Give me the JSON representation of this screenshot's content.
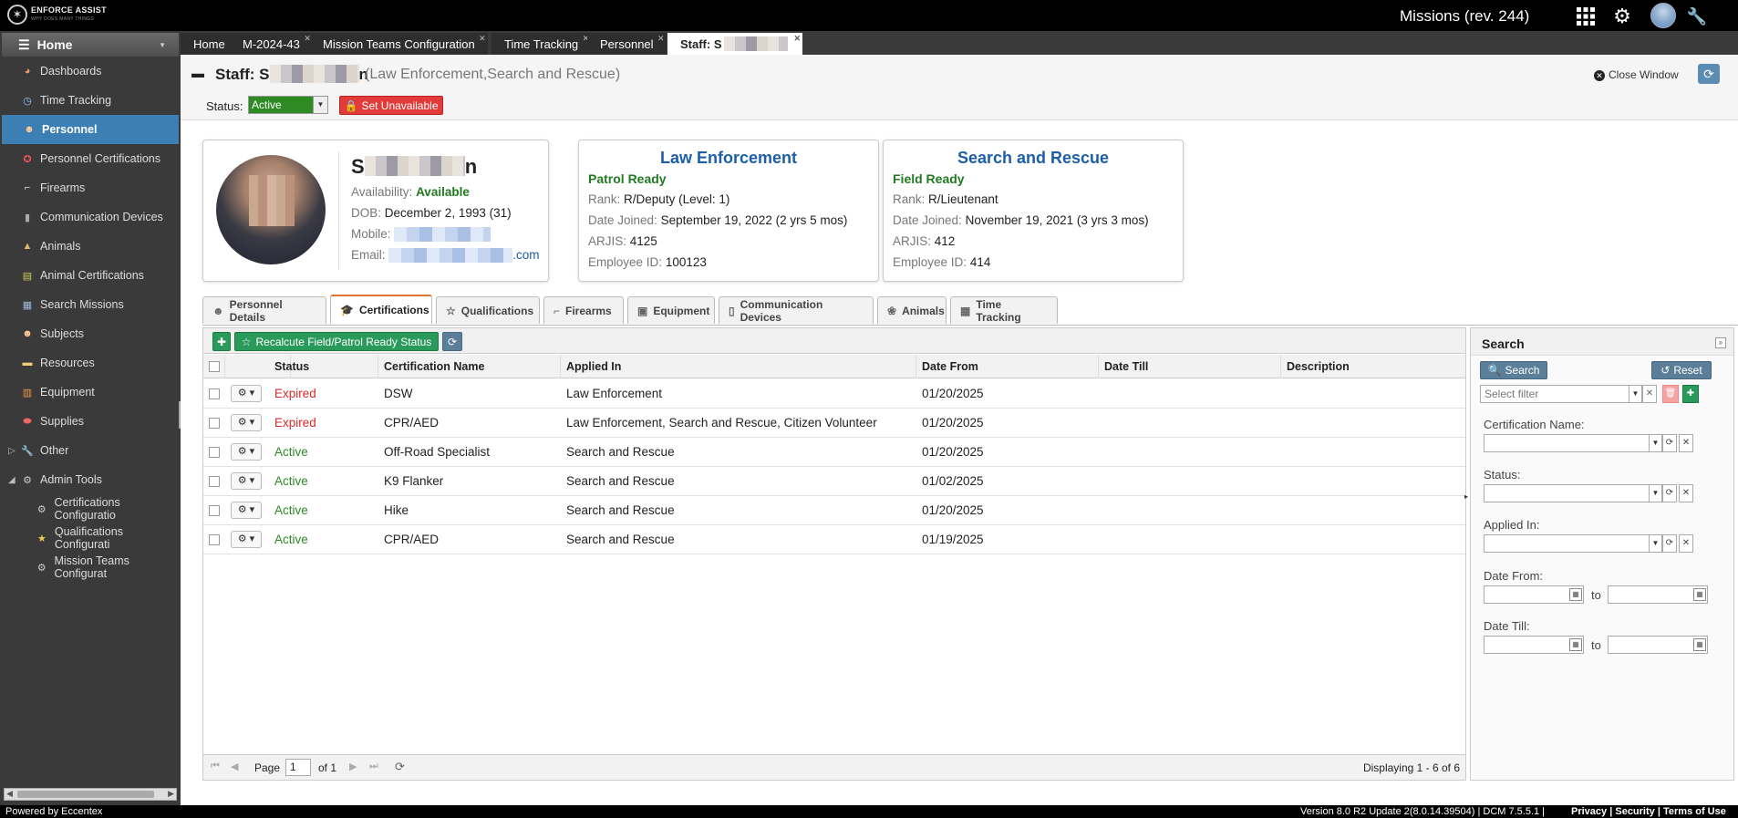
{
  "topbar": {
    "logo_text": "ENFORCE ASSIST",
    "logo_sub": "WHY DOES MANY THINGS",
    "app_title": "Missions (rev. 244)",
    "icons": [
      "grid-icon",
      "gear-icon",
      "avatar",
      "wrench-icon"
    ]
  },
  "sidebar": {
    "home_label": "Home",
    "items": [
      {
        "label": "Dashboards",
        "icon": "dashboard-icon"
      },
      {
        "label": "Time Tracking",
        "icon": "clock-icon"
      },
      {
        "label": "Personnel",
        "icon": "person-icon",
        "active": true
      },
      {
        "label": "Personnel Certifications",
        "icon": "certificate-icon"
      },
      {
        "label": "Firearms",
        "icon": "firearm-icon"
      },
      {
        "label": "Communication Devices",
        "icon": "radio-icon"
      },
      {
        "label": "Animals",
        "icon": "dog-icon"
      },
      {
        "label": "Animal Certifications",
        "icon": "certificate-icon"
      },
      {
        "label": "Search Missions",
        "icon": "document-icon"
      },
      {
        "label": "Subjects",
        "icon": "person-icon"
      },
      {
        "label": "Resources",
        "icon": "resource-icon"
      },
      {
        "label": "Equipment",
        "icon": "equipment-icon"
      },
      {
        "label": "Supplies",
        "icon": "supplies-icon"
      },
      {
        "label": "Other",
        "icon": "wrench-icon"
      },
      {
        "label": "Admin Tools",
        "icon": "gear-icon"
      },
      {
        "label": "Certifications Configuratio",
        "icon": "gear-icon",
        "sub": true
      },
      {
        "label": "Qualifications Configurati",
        "icon": "star-icon",
        "sub": true
      },
      {
        "label": "Mission Teams Configurat",
        "icon": "gear-icon",
        "sub": true
      }
    ]
  },
  "tabs": [
    {
      "label": "Home"
    },
    {
      "label": "M-2024-43"
    },
    {
      "label": "Mission Teams Configuration"
    },
    {
      "label": "Time Tracking"
    },
    {
      "label": "Personnel"
    },
    {
      "label": "Staff: S",
      "active": true
    }
  ],
  "header": {
    "title_prefix": "Staff: S",
    "title_suffix": "n",
    "subtitle": "(Law Enforcement,Search and Rescue)",
    "close_label": "Close Window",
    "status_label": "Status:",
    "status_value": "Active",
    "set_unavailable": "Set Unavailable"
  },
  "profile": {
    "name_prefix": "S",
    "name_suffix": "n",
    "availability_label": "Availability:",
    "availability_value": "Available",
    "dob_label": "DOB:",
    "dob_value": "December 2, 1993 (31)",
    "mobile_label": "Mobile:",
    "email_label": "Email:",
    "email_suffix": ".com"
  },
  "departments": [
    {
      "title": "Law Enforcement",
      "ready": "Patrol Ready",
      "rank_label": "Rank:",
      "rank": "R/Deputy (Level: 1)",
      "joined_label": "Date Joined:",
      "joined": "September 19, 2022 (2 yrs 5 mos)",
      "arjis_label": "ARJIS:",
      "arjis": "4125",
      "emp_label": "Employee ID:",
      "emp": "100123"
    },
    {
      "title": "Search and Rescue",
      "ready": "Field Ready",
      "rank_label": "Rank:",
      "rank": "R/Lieutenant",
      "joined_label": "Date Joined:",
      "joined": "November 19, 2021 (3 yrs 3 mos)",
      "arjis_label": "ARJIS:",
      "arjis": "412",
      "emp_label": "Employee ID:",
      "emp": "414"
    }
  ],
  "subtabs": [
    {
      "label": "Personnel Details",
      "icon": "person-icon"
    },
    {
      "label": "Certifications",
      "icon": "graduation-cap-icon",
      "active": true
    },
    {
      "label": "Qualifications",
      "icon": "star-icon"
    },
    {
      "label": "Firearms",
      "icon": "firearm-icon"
    },
    {
      "label": "Equipment",
      "icon": "briefcase-icon"
    },
    {
      "label": "Communication Devices",
      "icon": "mobile-icon"
    },
    {
      "label": "Animals",
      "icon": "paw-icon"
    },
    {
      "label": "Time Tracking",
      "icon": "calendar-icon"
    }
  ],
  "grid": {
    "recalc_label": "Recalcute Field/Patrol Ready Status",
    "columns": [
      "Status",
      "Certification Name",
      "Applied In",
      "Date From",
      "Date Till",
      "Description"
    ],
    "rows": [
      {
        "status": "Expired",
        "name": "DSW",
        "applied": "Law Enforcement",
        "from": "01/20/2025",
        "till": "",
        "desc": ""
      },
      {
        "status": "Expired",
        "name": "CPR/AED",
        "applied": "Law Enforcement, Search and Rescue, Citizen Volunteer",
        "from": "01/20/2025",
        "till": "",
        "desc": ""
      },
      {
        "status": "Active",
        "name": "Off-Road Specialist",
        "applied": "Search and Rescue",
        "from": "01/20/2025",
        "till": "",
        "desc": ""
      },
      {
        "status": "Active",
        "name": "K9 Flanker",
        "applied": "Search and Rescue",
        "from": "01/02/2025",
        "till": "",
        "desc": ""
      },
      {
        "status": "Active",
        "name": "Hike",
        "applied": "Search and Rescue",
        "from": "01/20/2025",
        "till": "",
        "desc": ""
      },
      {
        "status": "Active",
        "name": "CPR/AED",
        "applied": "Search and Rescue",
        "from": "01/19/2025",
        "till": "",
        "desc": ""
      }
    ],
    "page_label": "Page",
    "page_value": "1",
    "of_label": "of 1",
    "displaying": "Displaying 1 - 6 of 6"
  },
  "search": {
    "title": "Search",
    "search_btn": "Search",
    "reset_btn": "Reset",
    "filter_placeholder": "Select filter",
    "fields": [
      "Certification Name:",
      "Status:",
      "Applied In:"
    ],
    "date_from": "Date From:",
    "date_till": "Date Till:",
    "to": "to"
  },
  "footer": {
    "powered": "Powered by Eccentex",
    "version": "Version   8.0 R2 Update 2(8.0.14.39504) | DCM 7.5.5.1 |",
    "privacy": "Privacy",
    "security": "Security",
    "terms": "Terms of Use"
  },
  "colors": {
    "active_blue": "#3c7fb4",
    "ready_green": "#217a21",
    "expired_red": "#d52b2b",
    "dept_blue": "#1c5fa8"
  }
}
